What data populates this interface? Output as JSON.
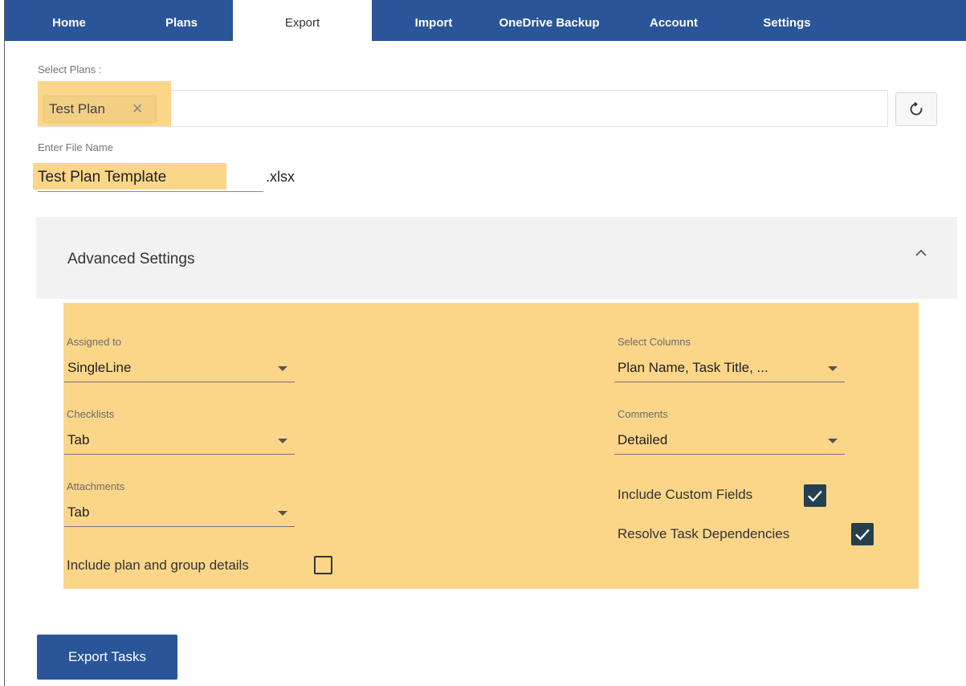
{
  "nav": {
    "tabs": [
      {
        "label": "Home"
      },
      {
        "label": "Plans"
      },
      {
        "label": "Export"
      },
      {
        "label": "Import"
      },
      {
        "label": "OneDrive Backup"
      },
      {
        "label": "Account"
      },
      {
        "label": "Settings"
      }
    ],
    "active": "Export"
  },
  "plans": {
    "label": "Select Plans :",
    "selected_chip": "Test Plan",
    "chip_close": "✕",
    "refresh_icon": "refresh-icon"
  },
  "filename": {
    "label": "Enter File Name",
    "value": "Test Plan Template",
    "extension": ".xlsx"
  },
  "advanced": {
    "title": "Advanced Settings",
    "expanded": true,
    "assigned_to": {
      "label": "Assigned to",
      "value": "SingleLine"
    },
    "checklists": {
      "label": "Checklists",
      "value": "Tab"
    },
    "attachments": {
      "label": "Attachments",
      "value": "Tab"
    },
    "include_plan_group": {
      "label": "Include plan and group details",
      "checked": false
    },
    "select_columns": {
      "label": "Select Columns",
      "value": "Plan Name, Task Title, ..."
    },
    "comments": {
      "label": "Comments",
      "value": "Detailed"
    },
    "include_custom_fields": {
      "label": "Include Custom Fields",
      "checked": true
    },
    "resolve_dependencies": {
      "label": "Resolve Task Dependencies",
      "checked": true
    }
  },
  "export_button": {
    "label": "Export Tasks"
  },
  "colors": {
    "nav_bg": "#2a5599",
    "highlight": "#fbd689",
    "checkbox_checked": "#24404f",
    "button_bg": "#2a5599"
  }
}
